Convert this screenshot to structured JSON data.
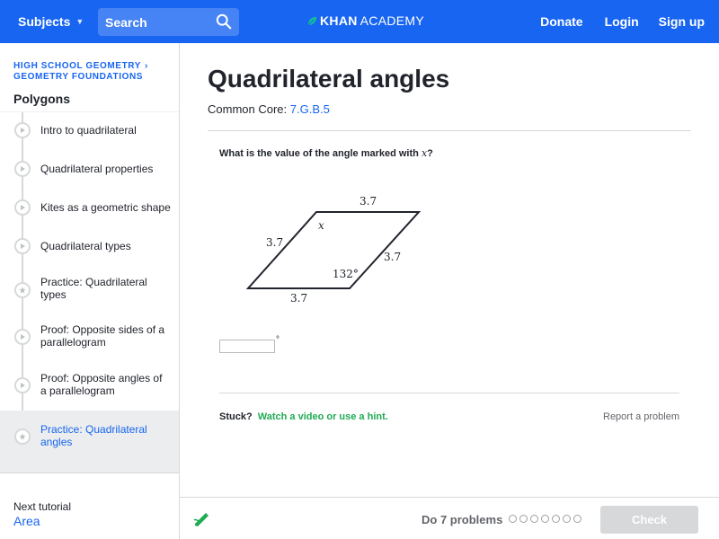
{
  "topbar": {
    "subjects_label": "Subjects",
    "search_placeholder": "Search",
    "logo_part1": "KHAN",
    "logo_part2": "ACADEMY",
    "donate_label": "Donate",
    "login_label": "Login",
    "signup_label": "Sign up",
    "color": "#1865f2"
  },
  "sidebar": {
    "breadcrumb_course": "HIGH SCHOOL GEOMETRY",
    "breadcrumb_unit": "GEOMETRY FOUNDATIONS",
    "unit_title": "Polygons",
    "items": [
      {
        "label": "Intro to quadrilateral",
        "icon": "play-icon"
      },
      {
        "label": "Quadrilateral properties",
        "icon": "play-icon"
      },
      {
        "label": "Kites as a geometric shape",
        "icon": "play-icon"
      },
      {
        "label": "Quadrilateral types",
        "icon": "play-icon"
      },
      {
        "label": "Practice: Quadrilateral types",
        "icon": "star-icon"
      },
      {
        "label": "Proof: Opposite sides of a parallelogram",
        "icon": "play-icon"
      },
      {
        "label": "Proof: Opposite angles of a parallelogram",
        "icon": "play-icon"
      },
      {
        "label": "Practice: Quadrilateral angles",
        "icon": "star-icon",
        "active": true
      }
    ],
    "next_tutorial_label": "Next tutorial",
    "next_tutorial_value": "Area"
  },
  "main": {
    "title": "Quadrilateral angles",
    "common_core_label": "Common Core:",
    "common_core_code": "7.G.B.5",
    "question_prefix": "What is the value of the angle marked with",
    "question_var": "x",
    "question_suffix": "?",
    "figure": {
      "side_top": "3.7",
      "side_left": "3.7",
      "side_right": "3.7",
      "side_bottom": "3.7",
      "angle_label": "x",
      "given_angle": "132°"
    },
    "answer_value": "",
    "answer_unit": "°",
    "stuck_label": "Stuck?",
    "hint_label": "Watch a video or use a hint.",
    "report_label": "Report a problem"
  },
  "bottombar": {
    "do_problems_label": "Do 7 problems",
    "progress_total": 7,
    "progress_done": 0,
    "check_label": "Check",
    "check_enabled": false,
    "accent_green": "#1fab54"
  }
}
